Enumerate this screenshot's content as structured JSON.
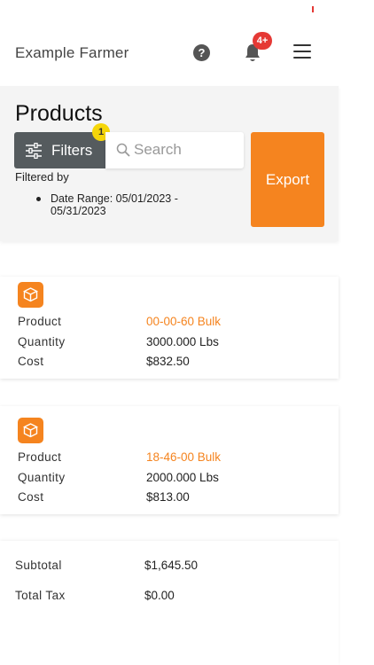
{
  "header": {
    "app_title": "Example Farmer",
    "help_icon_glyph": "?",
    "notification_badge": "4+"
  },
  "products": {
    "title": "Products",
    "filters_label": "Filters",
    "filters_count": "1",
    "search_placeholder": "Search",
    "export_label": "Export",
    "filtered_by_label": "Filtered by",
    "active_filters": [
      "Date Range: 05/01/2023 - 05/31/2023"
    ]
  },
  "items": [
    {
      "product_label": "Product",
      "product_value": "00-00-60 Bulk",
      "quantity_label": "Quantity",
      "quantity_value": "3000.000 Lbs",
      "cost_label": "Cost",
      "cost_value": "$832.50"
    },
    {
      "product_label": "Product",
      "product_value": "18-46-00 Bulk",
      "quantity_label": "Quantity",
      "quantity_value": "2000.000 Lbs",
      "cost_label": "Cost",
      "cost_value": "$813.00"
    }
  ],
  "summary": {
    "subtotal_label": "Subtotal",
    "subtotal_value": "$1,645.50",
    "tax_label": "Total Tax",
    "tax_value": "$0.00"
  },
  "colors": {
    "accent": "#f5841f",
    "notification": "#e53935",
    "filter_badge": "#f5d60a",
    "filters_button": "#555b5e"
  },
  "icons": {
    "help": "help-circle-icon",
    "notifications": "bell-icon",
    "menu": "hamburger-menu-icon",
    "filters": "sliders-icon",
    "search": "magnifier-icon",
    "product": "box-icon"
  }
}
